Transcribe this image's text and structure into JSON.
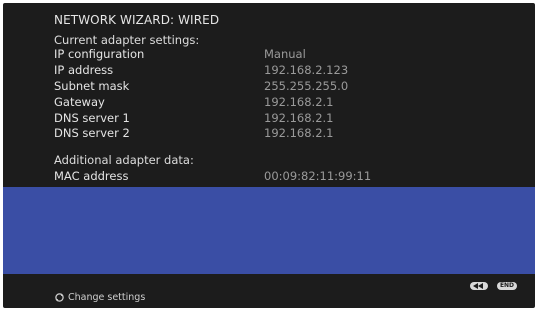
{
  "wizard": {
    "title": "NETWORK WIZARD: WIRED"
  },
  "current": {
    "heading": "Current adapter settings:",
    "rows": [
      {
        "label": "IP configuration",
        "value": "Manual"
      },
      {
        "label": "IP address",
        "value": "192.168.2.123"
      },
      {
        "label": "Subnet mask",
        "value": "255.255.255.0"
      },
      {
        "label": "Gateway",
        "value": "192.168.2.1"
      },
      {
        "label": "DNS server 1",
        "value": "192.168.2.1"
      },
      {
        "label": "DNS server 2",
        "value": "192.168.2.1"
      }
    ]
  },
  "additional": {
    "heading": "Additional adapter data:",
    "rows": [
      {
        "label": "MAC address",
        "value": "00:09:82:11:99:11"
      }
    ]
  },
  "footer": {
    "hint_label": "Change settings",
    "hint_icon": "change-arrows-icon",
    "back_button_icon": "rewind-icon",
    "end_label": "END"
  },
  "colors": {
    "background": "#1c1c1c",
    "panel": "#3a4ea5",
    "label": "#e4e4e4",
    "value": "#9a9a9a"
  }
}
